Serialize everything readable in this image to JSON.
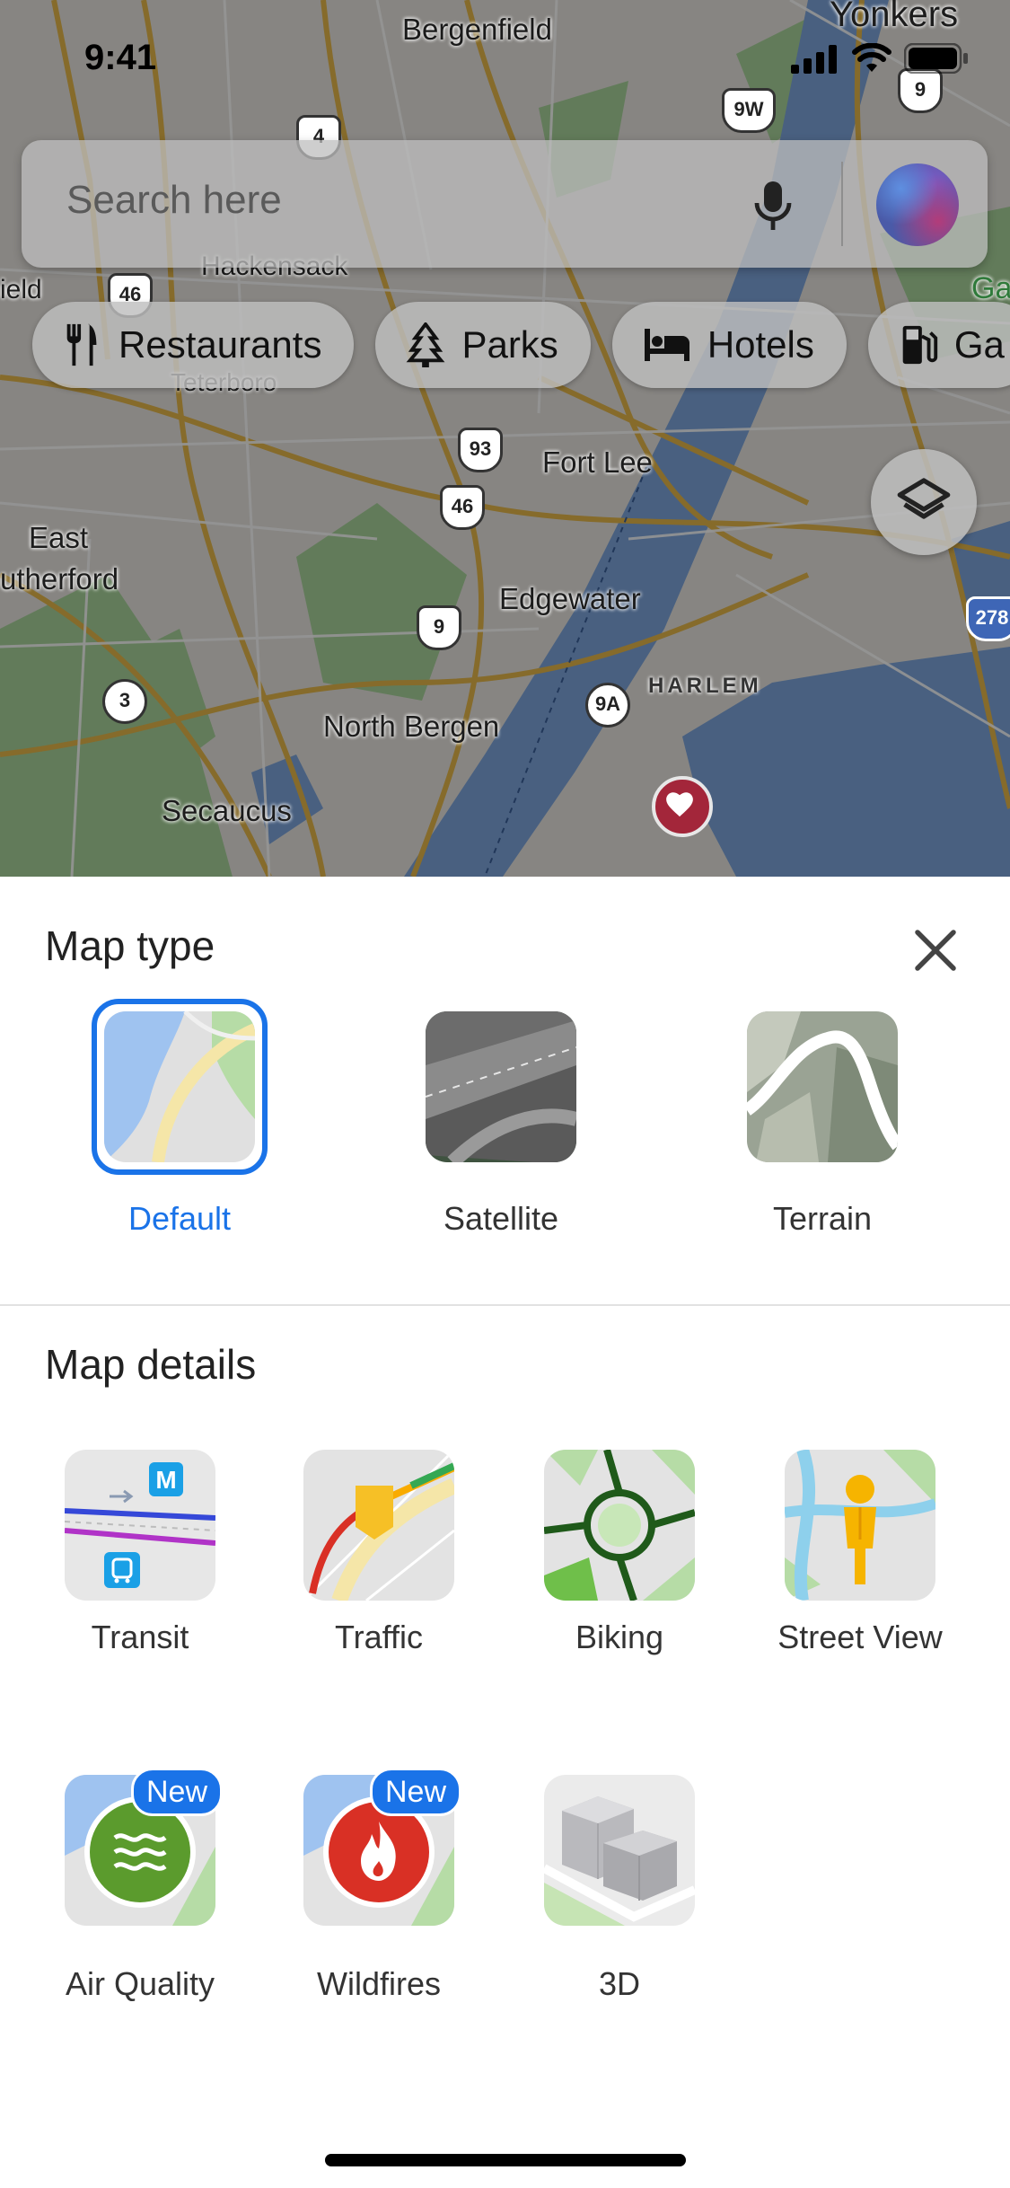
{
  "status_bar": {
    "time": "9:41"
  },
  "map": {
    "labels": {
      "bergenfield": "Bergenfield",
      "yonkers": "Yonkers",
      "hackensack": "Hackensack",
      "ield": "ield",
      "fort_lee": "Fort Lee",
      "east": "East",
      "rutherford": "utherford",
      "edgewater": "Edgewater",
      "harlem": "HARLEM",
      "north_bergen": "North Bergen",
      "secaucus": "Secaucus",
      "teterboro": "Teterboro",
      "garden": "Gard"
    },
    "shields": {
      "s4": "4",
      "s9w": "9W",
      "s9": "9",
      "s46a": "46",
      "s93": "93",
      "s46": "46",
      "s9b": "9",
      "s3": "3",
      "s9a": "9A",
      "s278": "278"
    }
  },
  "search": {
    "placeholder": "Search here"
  },
  "chips": [
    {
      "label": "Restaurants",
      "icon": "fork-knife-icon"
    },
    {
      "label": "Parks",
      "icon": "tree-icon"
    },
    {
      "label": "Hotels",
      "icon": "bed-icon"
    },
    {
      "label": "Ga",
      "icon": "gas-pump-icon"
    }
  ],
  "sheet": {
    "map_type_title": "Map type",
    "map_types": [
      {
        "label": "Default",
        "selected": true
      },
      {
        "label": "Satellite",
        "selected": false
      },
      {
        "label": "Terrain",
        "selected": false
      }
    ],
    "map_details_title": "Map details",
    "details": [
      {
        "label": "Transit",
        "badge": ""
      },
      {
        "label": "Traffic",
        "badge": ""
      },
      {
        "label": "Biking",
        "badge": ""
      },
      {
        "label": "Street View",
        "badge": ""
      },
      {
        "label": "Air Quality",
        "badge": "New"
      },
      {
        "label": "Wildfires",
        "badge": "New"
      },
      {
        "label": "3D",
        "badge": ""
      }
    ]
  },
  "colors": {
    "accent": "#1a73e8",
    "selected_label": "#1a73e8"
  }
}
